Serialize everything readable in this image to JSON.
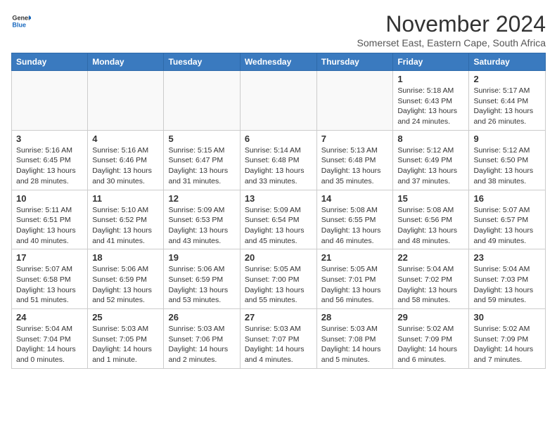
{
  "header": {
    "logo_general": "General",
    "logo_blue": "Blue",
    "month_title": "November 2024",
    "subtitle": "Somerset East, Eastern Cape, South Africa"
  },
  "days_of_week": [
    "Sunday",
    "Monday",
    "Tuesday",
    "Wednesday",
    "Thursday",
    "Friday",
    "Saturday"
  ],
  "weeks": [
    [
      {
        "day": "",
        "info": ""
      },
      {
        "day": "",
        "info": ""
      },
      {
        "day": "",
        "info": ""
      },
      {
        "day": "",
        "info": ""
      },
      {
        "day": "",
        "info": ""
      },
      {
        "day": "1",
        "info": "Sunrise: 5:18 AM\nSunset: 6:43 PM\nDaylight: 13 hours\nand 24 minutes."
      },
      {
        "day": "2",
        "info": "Sunrise: 5:17 AM\nSunset: 6:44 PM\nDaylight: 13 hours\nand 26 minutes."
      }
    ],
    [
      {
        "day": "3",
        "info": "Sunrise: 5:16 AM\nSunset: 6:45 PM\nDaylight: 13 hours\nand 28 minutes."
      },
      {
        "day": "4",
        "info": "Sunrise: 5:16 AM\nSunset: 6:46 PM\nDaylight: 13 hours\nand 30 minutes."
      },
      {
        "day": "5",
        "info": "Sunrise: 5:15 AM\nSunset: 6:47 PM\nDaylight: 13 hours\nand 31 minutes."
      },
      {
        "day": "6",
        "info": "Sunrise: 5:14 AM\nSunset: 6:48 PM\nDaylight: 13 hours\nand 33 minutes."
      },
      {
        "day": "7",
        "info": "Sunrise: 5:13 AM\nSunset: 6:48 PM\nDaylight: 13 hours\nand 35 minutes."
      },
      {
        "day": "8",
        "info": "Sunrise: 5:12 AM\nSunset: 6:49 PM\nDaylight: 13 hours\nand 37 minutes."
      },
      {
        "day": "9",
        "info": "Sunrise: 5:12 AM\nSunset: 6:50 PM\nDaylight: 13 hours\nand 38 minutes."
      }
    ],
    [
      {
        "day": "10",
        "info": "Sunrise: 5:11 AM\nSunset: 6:51 PM\nDaylight: 13 hours\nand 40 minutes."
      },
      {
        "day": "11",
        "info": "Sunrise: 5:10 AM\nSunset: 6:52 PM\nDaylight: 13 hours\nand 41 minutes."
      },
      {
        "day": "12",
        "info": "Sunrise: 5:09 AM\nSunset: 6:53 PM\nDaylight: 13 hours\nand 43 minutes."
      },
      {
        "day": "13",
        "info": "Sunrise: 5:09 AM\nSunset: 6:54 PM\nDaylight: 13 hours\nand 45 minutes."
      },
      {
        "day": "14",
        "info": "Sunrise: 5:08 AM\nSunset: 6:55 PM\nDaylight: 13 hours\nand 46 minutes."
      },
      {
        "day": "15",
        "info": "Sunrise: 5:08 AM\nSunset: 6:56 PM\nDaylight: 13 hours\nand 48 minutes."
      },
      {
        "day": "16",
        "info": "Sunrise: 5:07 AM\nSunset: 6:57 PM\nDaylight: 13 hours\nand 49 minutes."
      }
    ],
    [
      {
        "day": "17",
        "info": "Sunrise: 5:07 AM\nSunset: 6:58 PM\nDaylight: 13 hours\nand 51 minutes."
      },
      {
        "day": "18",
        "info": "Sunrise: 5:06 AM\nSunset: 6:59 PM\nDaylight: 13 hours\nand 52 minutes."
      },
      {
        "day": "19",
        "info": "Sunrise: 5:06 AM\nSunset: 6:59 PM\nDaylight: 13 hours\nand 53 minutes."
      },
      {
        "day": "20",
        "info": "Sunrise: 5:05 AM\nSunset: 7:00 PM\nDaylight: 13 hours\nand 55 minutes."
      },
      {
        "day": "21",
        "info": "Sunrise: 5:05 AM\nSunset: 7:01 PM\nDaylight: 13 hours\nand 56 minutes."
      },
      {
        "day": "22",
        "info": "Sunrise: 5:04 AM\nSunset: 7:02 PM\nDaylight: 13 hours\nand 58 minutes."
      },
      {
        "day": "23",
        "info": "Sunrise: 5:04 AM\nSunset: 7:03 PM\nDaylight: 13 hours\nand 59 minutes."
      }
    ],
    [
      {
        "day": "24",
        "info": "Sunrise: 5:04 AM\nSunset: 7:04 PM\nDaylight: 14 hours\nand 0 minutes."
      },
      {
        "day": "25",
        "info": "Sunrise: 5:03 AM\nSunset: 7:05 PM\nDaylight: 14 hours\nand 1 minute."
      },
      {
        "day": "26",
        "info": "Sunrise: 5:03 AM\nSunset: 7:06 PM\nDaylight: 14 hours\nand 2 minutes."
      },
      {
        "day": "27",
        "info": "Sunrise: 5:03 AM\nSunset: 7:07 PM\nDaylight: 14 hours\nand 4 minutes."
      },
      {
        "day": "28",
        "info": "Sunrise: 5:03 AM\nSunset: 7:08 PM\nDaylight: 14 hours\nand 5 minutes."
      },
      {
        "day": "29",
        "info": "Sunrise: 5:02 AM\nSunset: 7:09 PM\nDaylight: 14 hours\nand 6 minutes."
      },
      {
        "day": "30",
        "info": "Sunrise: 5:02 AM\nSunset: 7:09 PM\nDaylight: 14 hours\nand 7 minutes."
      }
    ]
  ]
}
